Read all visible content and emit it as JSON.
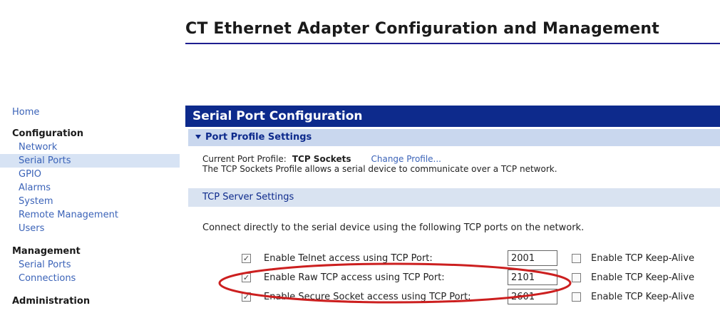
{
  "page": {
    "title": "CT Ethernet Adapter Configuration and Management"
  },
  "sidebar": {
    "home": "Home",
    "configuration": {
      "heading": "Configuration",
      "items": [
        "Network",
        "Serial Ports",
        "GPIO",
        "Alarms",
        "System",
        "Remote Management",
        "Users"
      ],
      "active": "Serial Ports"
    },
    "management": {
      "heading": "Management",
      "items": [
        "Serial Ports",
        "Connections"
      ]
    },
    "administration": {
      "heading": "Administration"
    }
  },
  "main": {
    "section_title": "Serial Port Configuration",
    "port_profile": {
      "header": "Port Profile Settings",
      "current_label": "Current Port Profile:",
      "current_value": "TCP Sockets",
      "change_link": "Change Profile...",
      "description": "The TCP Sockets Profile allows a serial device to communicate over a TCP network."
    },
    "tcp_server": {
      "header": "TCP Server Settings",
      "description": "Connect directly to the serial device using the following TCP ports on the network.",
      "rows": [
        {
          "label": "Enable Telnet access using TCP Port:",
          "enabled": true,
          "port": "2001",
          "keepalive_label": "Enable TCP Keep-Alive",
          "keepalive": false
        },
        {
          "label": "Enable Raw TCP access using TCP Port:",
          "enabled": true,
          "port": "2101",
          "keepalive_label": "Enable TCP Keep-Alive",
          "keepalive": false
        },
        {
          "label": "Enable Secure Socket access using TCP Port:",
          "enabled": true,
          "port": "2601",
          "keepalive_label": "Enable TCP Keep-Alive",
          "keepalive": false
        }
      ]
    }
  },
  "colors": {
    "header_blue": "#0d2a8c",
    "link_blue": "#3b63b8",
    "subheader_bg": "#c9d7ee",
    "active_nav_bg": "#d7e3f4",
    "annotation_red": "#cc1f1f"
  }
}
